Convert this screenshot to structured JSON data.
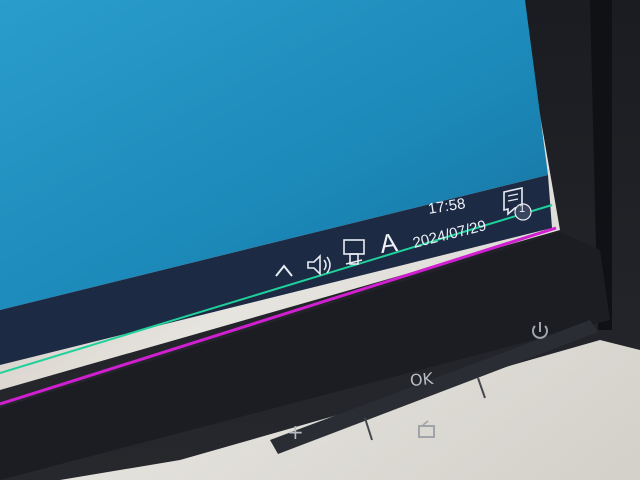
{
  "taskbar": {
    "time": "17:58",
    "date": "2024/07/29",
    "ime_indicator": "A",
    "notification_badge": "1",
    "icons": [
      "chevron-up-icon",
      "volume-icon",
      "network-icon",
      "action-center-icon"
    ]
  },
  "monitor_buttons": {
    "plus_label": "+",
    "ok_label": "OK",
    "power_icon": "power-icon",
    "input_icon": "input-source-icon"
  },
  "colors": {
    "screen": "#1f8fbf",
    "taskbar": "#1d2a44",
    "bezel": "#16181c",
    "green_line": "#1fd19a",
    "magenta_line": "#d01fd0"
  }
}
